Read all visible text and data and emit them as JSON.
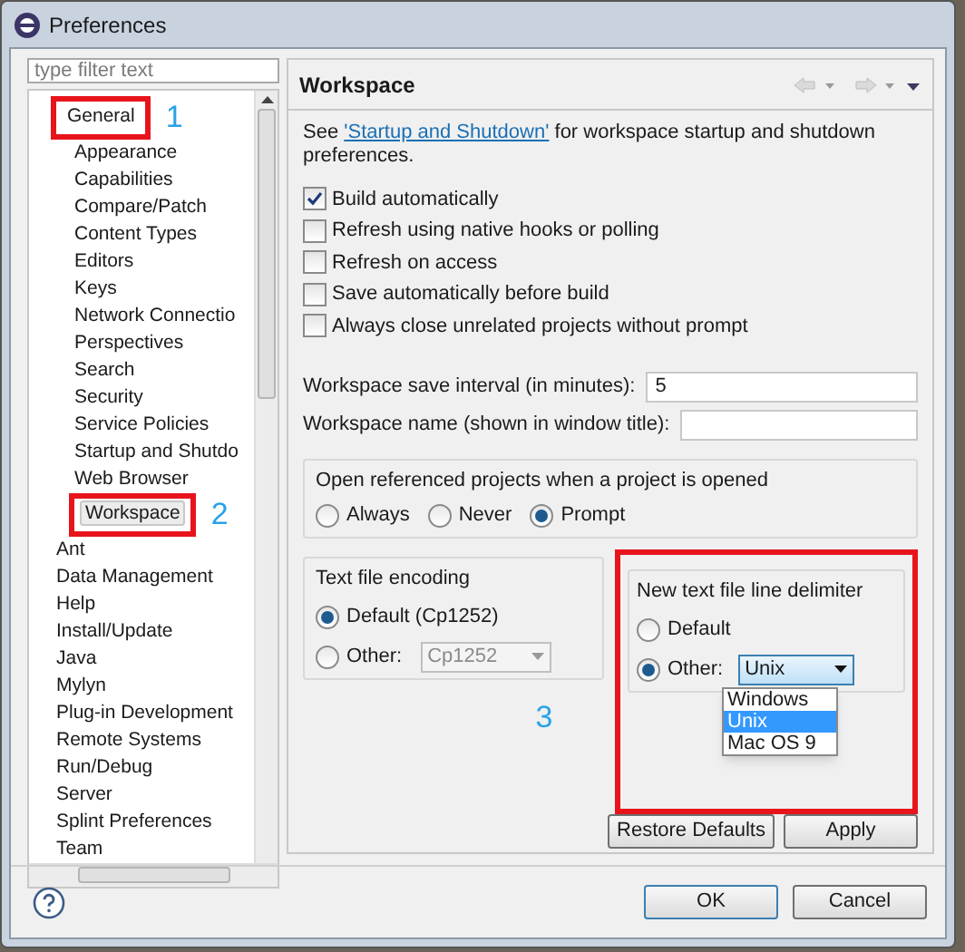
{
  "window": {
    "title": "Preferences"
  },
  "filter": {
    "placeholder": "type filter text"
  },
  "tree": [
    {
      "label": "General",
      "selected": false,
      "annotation": "1",
      "children": [
        {
          "label": "Appearance",
          "selected": false
        },
        {
          "label": "Capabilities",
          "selected": false
        },
        {
          "label": "Compare/Patch",
          "selected": false
        },
        {
          "label": "Content Types",
          "selected": false
        },
        {
          "label": "Editors",
          "selected": false
        },
        {
          "label": "Keys",
          "selected": false
        },
        {
          "label": "Network Connectio",
          "selected": false
        },
        {
          "label": "Perspectives",
          "selected": false
        },
        {
          "label": "Search",
          "selected": false
        },
        {
          "label": "Security",
          "selected": false
        },
        {
          "label": "Service Policies",
          "selected": false
        },
        {
          "label": "Startup and Shutdo",
          "selected": false
        },
        {
          "label": "Web Browser",
          "selected": false
        },
        {
          "label": "Workspace",
          "selected": true,
          "annotation": "2"
        }
      ]
    },
    {
      "label": "Ant",
      "selected": false
    },
    {
      "label": "Data Management",
      "selected": false
    },
    {
      "label": "Help",
      "selected": false
    },
    {
      "label": "Install/Update",
      "selected": false
    },
    {
      "label": "Java",
      "selected": false
    },
    {
      "label": "Mylyn",
      "selected": false
    },
    {
      "label": "Plug-in Development",
      "selected": false
    },
    {
      "label": "Remote Systems",
      "selected": false
    },
    {
      "label": "Run/Debug",
      "selected": false
    },
    {
      "label": "Server",
      "selected": false
    },
    {
      "label": "Splint Preferences",
      "selected": false
    },
    {
      "label": "Team",
      "selected": false
    }
  ],
  "page": {
    "title": "Workspace",
    "intro_before": "See ",
    "intro_link": "'Startup and Shutdown'",
    "intro_after": " for workspace startup and shutdown preferences.",
    "checkboxes": [
      {
        "label": "Build automatically",
        "checked": true
      },
      {
        "label": "Refresh using native hooks or polling",
        "checked": false
      },
      {
        "label": "Refresh on access",
        "checked": false
      },
      {
        "label": "Save automatically before build",
        "checked": false
      },
      {
        "label": "Always close unrelated projects without prompt",
        "checked": false
      }
    ],
    "fields": [
      {
        "label": "Workspace save interval (in minutes):",
        "value": "5"
      },
      {
        "label": "Workspace name (shown in window title):"
      }
    ],
    "open_projects": {
      "title": "Open referenced projects when a project is opened",
      "options": [
        {
          "label": "Always",
          "selected": false
        },
        {
          "label": "Never",
          "selected": false
        },
        {
          "label": "Prompt",
          "selected": true
        }
      ]
    },
    "encoding": {
      "title": "Text file encoding",
      "default_label": "Default (Cp1252)",
      "default_selected": true,
      "other_label": "Other:",
      "other_selected": false,
      "other_value": "Cp1252"
    },
    "delimiter": {
      "title": "New text file line delimiter",
      "annotation": "3",
      "default_label": "Default",
      "default_selected": false,
      "other_label": "Other:",
      "other_selected": true,
      "other_value": "Unix",
      "menu": [
        {
          "label": "Windows",
          "selected": false
        },
        {
          "label": "Unix",
          "selected": true
        },
        {
          "label": "Mac OS 9",
          "selected": false
        }
      ]
    },
    "buttons": [
      "Restore Defaults",
      "Apply"
    ]
  },
  "dialog_buttons": [
    "OK",
    "Cancel"
  ]
}
